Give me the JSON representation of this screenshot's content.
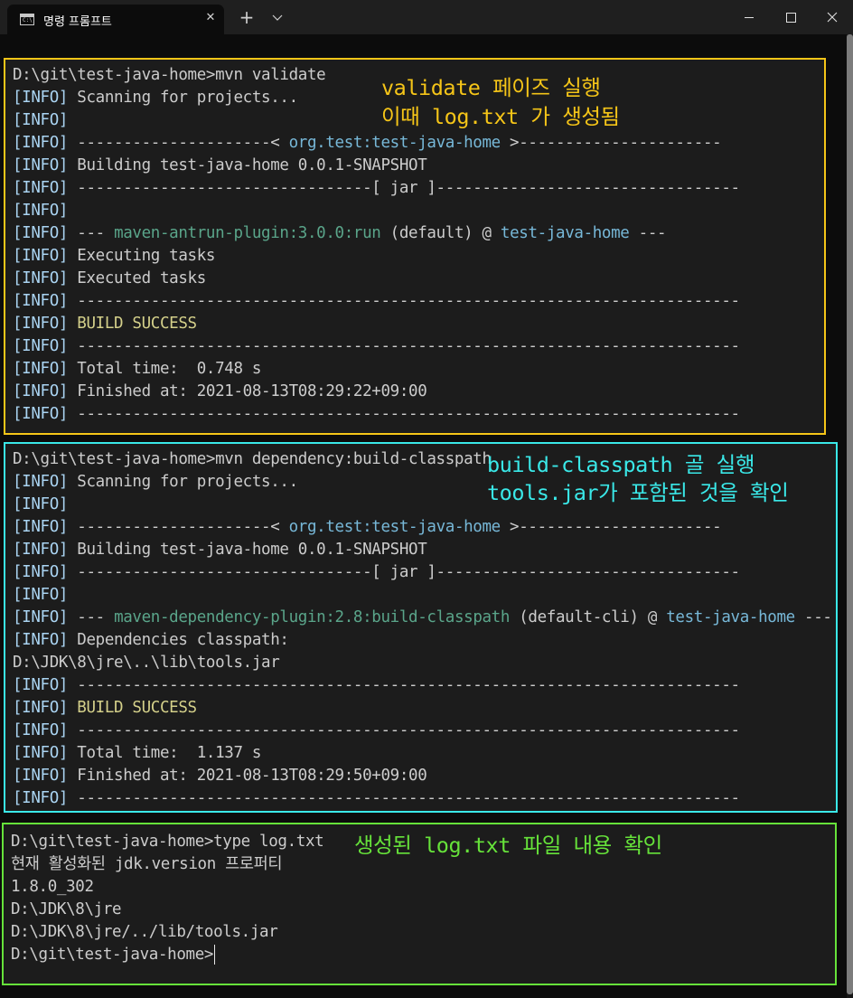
{
  "window": {
    "tab_title": "명령 프롬프트",
    "tab_icon_text": "C:\\",
    "close_tab_glyph": "✕",
    "new_tab_glyph": "+"
  },
  "colors": {
    "background": "#0c0c0c",
    "panel1_border": "#f5c518",
    "panel2_border": "#3ae8e8",
    "panel3_border": "#66e23a",
    "info_tag": "#aad4f2",
    "plugin_name": "#5aa58a",
    "artifact_name": "#77b8d8",
    "build_success": "#d4d08a"
  },
  "icons": {
    "tab": "command-prompt-icon",
    "dropdown": "chevron-down-icon",
    "minimize": "minimize-icon",
    "maximize": "maximize-icon",
    "close": "close-icon"
  },
  "validate": {
    "prompt": "D:\\git\\test-java-home>mvn validate",
    "tag": "[INFO]",
    "scanning": " Scanning for projects...",
    "sep_left": " ---------------------< ",
    "coords": "org.test:test-java-home",
    "sep_right": " >----------------------",
    "building": " Building test-java-home 0.0.1-SNAPSHOT",
    "jar_sep": " --------------------------------[ jar ]---------------------------------",
    "exec_prefix": " --- ",
    "plugin": "maven-antrun-plugin:3.0.0:run",
    "exec_mid": " (default) @ ",
    "artifact": "test-java-home",
    "exec_suffix": " ---",
    "executing": " Executing tasks",
    "executed": " Executed tasks",
    "dash_line": " ------------------------------------------------------------------------",
    "build_success": " BUILD SUCCESS",
    "total_time": " Total time:  0.748 s",
    "finished": " Finished at: 2021-08-13T08:29:22+09:00",
    "note_line1": "validate 페이즈 실행",
    "note_line2": "이때 log.txt 가 생성됨"
  },
  "dependency": {
    "prompt": "D:\\git\\test-java-home>mvn dependency:build-classpath",
    "tag": "[INFO]",
    "scanning": " Scanning for projects...",
    "sep_left": " ---------------------< ",
    "coords": "org.test:test-java-home",
    "sep_right": " >----------------------",
    "building": " Building test-java-home 0.0.1-SNAPSHOT",
    "jar_sep": " --------------------------------[ jar ]---------------------------------",
    "exec_prefix": " --- ",
    "plugin": "maven-dependency-plugin:2.8:build-classpath",
    "exec_mid": " (default-cli) @ ",
    "artifact": "test-java-home",
    "exec_suffix": " ---",
    "deps_classpath": " Dependencies classpath:",
    "classpath_value": "D:\\JDK\\8\\jre\\..\\lib\\tools.jar",
    "dash_line": " ------------------------------------------------------------------------",
    "build_success": " BUILD SUCCESS",
    "total_time": " Total time:  1.137 s",
    "finished": " Finished at: 2021-08-13T08:29:50+09:00",
    "note_line1": "build-classpath 골 실행",
    "note_line2": "tools.jar가 포함된 것을 확인"
  },
  "typelog": {
    "prompt": "D:\\git\\test-java-home>type log.txt",
    "line1": "현재 활성화된 jdk.version 프로퍼티",
    "line2": "1.8.0_302",
    "line3": "D:\\JDK\\8\\jre",
    "line4": "D:\\JDK\\8\\jre/../lib/tools.jar",
    "final_prompt": "D:\\git\\test-java-home>",
    "note": "생성된 log.txt 파일 내용 확인"
  }
}
